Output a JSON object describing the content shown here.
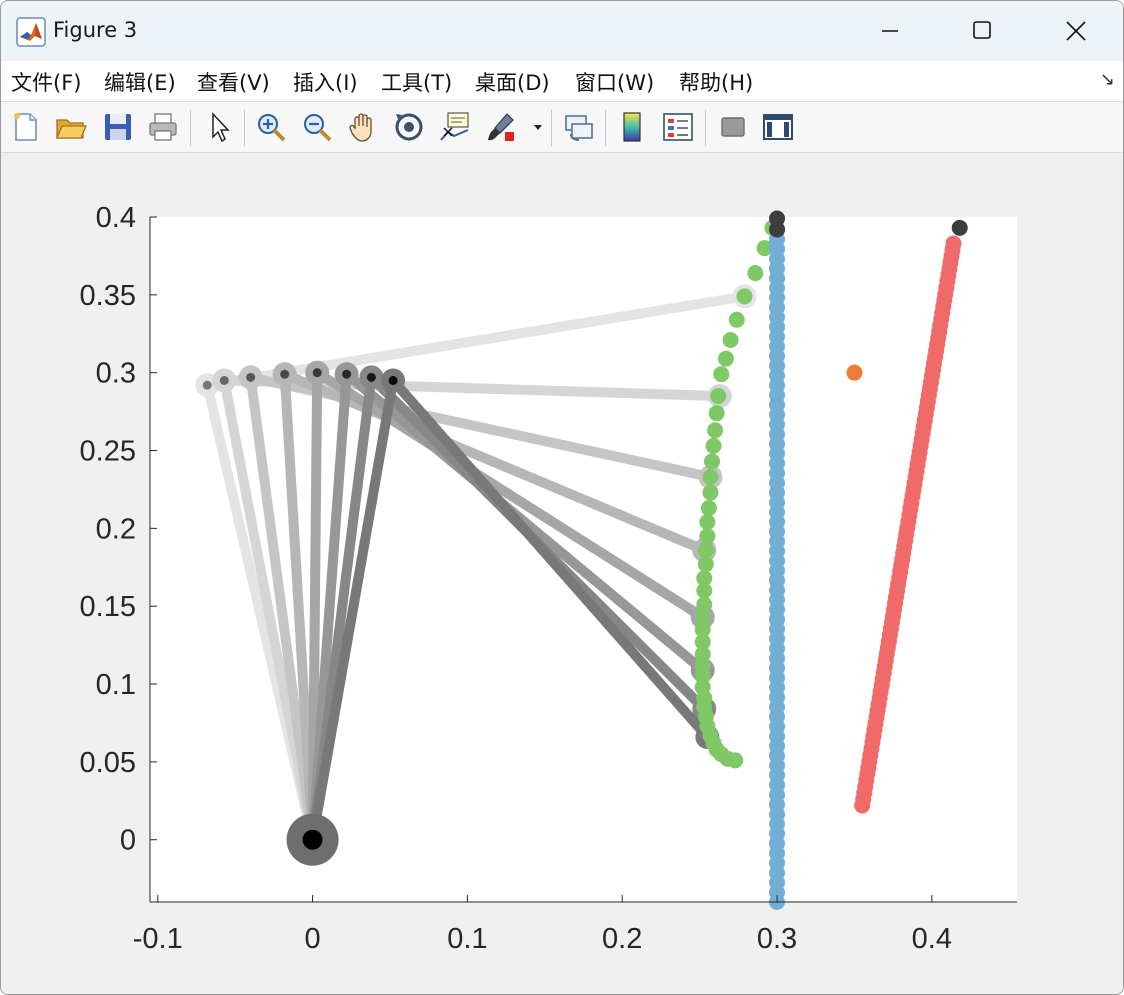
{
  "window": {
    "title": "Figure 3",
    "controls": [
      "minimize",
      "maximize",
      "close"
    ]
  },
  "menu": {
    "items": [
      "文件(F)",
      "编辑(E)",
      "查看(V)",
      "插入(I)",
      "工具(T)",
      "桌面(D)",
      "窗口(W)",
      "帮助(H)"
    ]
  },
  "toolbar": {
    "buttons": [
      "new-figure",
      "open-file",
      "save",
      "print",
      "edit-plot-arrow",
      "zoom-in",
      "zoom-out",
      "pan",
      "rotate-3d",
      "data-cursor",
      "brush",
      "link-plot",
      "colorbar",
      "legend",
      "hide-plot-tools",
      "show-plot-tools"
    ]
  },
  "colors": {
    "green": "#7ec866",
    "blue": "#73aed6",
    "red": "#f06a6a",
    "orange": "#f07a3a",
    "dark": "#3d3d3d",
    "axes_bg": "#ffffff",
    "figure_bg": "#f0f0f0"
  },
  "chart_data": {
    "type": "scatter",
    "title": "",
    "xlabel": "",
    "ylabel": "",
    "xlim": [
      -0.105,
      0.455
    ],
    "ylim": [
      -0.04,
      0.4
    ],
    "xticks": [
      -0.1,
      0,
      0.1,
      0.2,
      0.3,
      0.4
    ],
    "xtick_labels": [
      "-0.1",
      "0",
      "0.1",
      "0.2",
      "0.3",
      "0.4"
    ],
    "yticks": [
      0,
      0.05,
      0.1,
      0.15,
      0.2,
      0.25,
      0.3,
      0.35,
      0.4
    ],
    "ytick_labels": [
      "0",
      "0.05",
      "0.1",
      "0.15",
      "0.2",
      "0.25",
      "0.3",
      "0.35",
      "0.4"
    ],
    "grid": false,
    "base_point": {
      "x": 0,
      "y": 0
    },
    "arm_configurations": [
      {
        "elbow": [
          -0.068,
          0.292
        ],
        "tip": [
          0.279,
          0.349
        ]
      },
      {
        "elbow": [
          -0.057,
          0.295
        ],
        "tip": [
          0.263,
          0.285
        ]
      },
      {
        "elbow": [
          -0.04,
          0.297
        ],
        "tip": [
          0.257,
          0.233
        ]
      },
      {
        "elbow": [
          -0.018,
          0.299
        ],
        "tip": [
          0.253,
          0.186
        ]
      },
      {
        "elbow": [
          0.003,
          0.3
        ],
        "tip": [
          0.252,
          0.143
        ]
      },
      {
        "elbow": [
          0.022,
          0.299
        ],
        "tip": [
          0.252,
          0.109
        ]
      },
      {
        "elbow": [
          0.038,
          0.297
        ],
        "tip": [
          0.253,
          0.084
        ]
      },
      {
        "elbow": [
          0.052,
          0.295
        ],
        "tip": [
          0.255,
          0.066
        ]
      }
    ],
    "series": [
      {
        "color": "#7ec866",
        "x": [
          0.297,
          0.292,
          0.286,
          0.279,
          0.274,
          0.27,
          0.267,
          0.264,
          0.262,
          0.261,
          0.26,
          0.259,
          0.258,
          0.257,
          0.257,
          0.256,
          0.255,
          0.255,
          0.254,
          0.254,
          0.253,
          0.253,
          0.253,
          0.252,
          0.252,
          0.252,
          0.252,
          0.252,
          0.252,
          0.252,
          0.253,
          0.253,
          0.254,
          0.255,
          0.257,
          0.259,
          0.261,
          0.264,
          0.268,
          0.273
        ],
        "y": [
          0.393,
          0.38,
          0.364,
          0.349,
          0.334,
          0.321,
          0.309,
          0.299,
          0.285,
          0.274,
          0.263,
          0.253,
          0.243,
          0.233,
          0.223,
          0.213,
          0.204,
          0.195,
          0.186,
          0.177,
          0.168,
          0.16,
          0.151,
          0.143,
          0.135,
          0.127,
          0.119,
          0.112,
          0.105,
          0.098,
          0.091,
          0.085,
          0.079,
          0.073,
          0.067,
          0.062,
          0.058,
          0.055,
          0.052,
          0.051
        ]
      },
      {
        "color": "#73aed6",
        "x_constant": 0.3,
        "y_range": [
          -0.04,
          0.392
        ],
        "count": 70
      },
      {
        "color": "#f06a6a",
        "x_range": [
          0.355,
          0.414
        ],
        "y_range": [
          0.022,
          0.383
        ],
        "count": 90
      },
      {
        "color": "#f07a3a",
        "x": [
          0.35
        ],
        "y": [
          0.3
        ]
      },
      {
        "color": "#3d3d3d",
        "x": [
          0.3,
          0.3,
          0.418
        ],
        "y": [
          0.399,
          0.392,
          0.393
        ]
      }
    ]
  }
}
